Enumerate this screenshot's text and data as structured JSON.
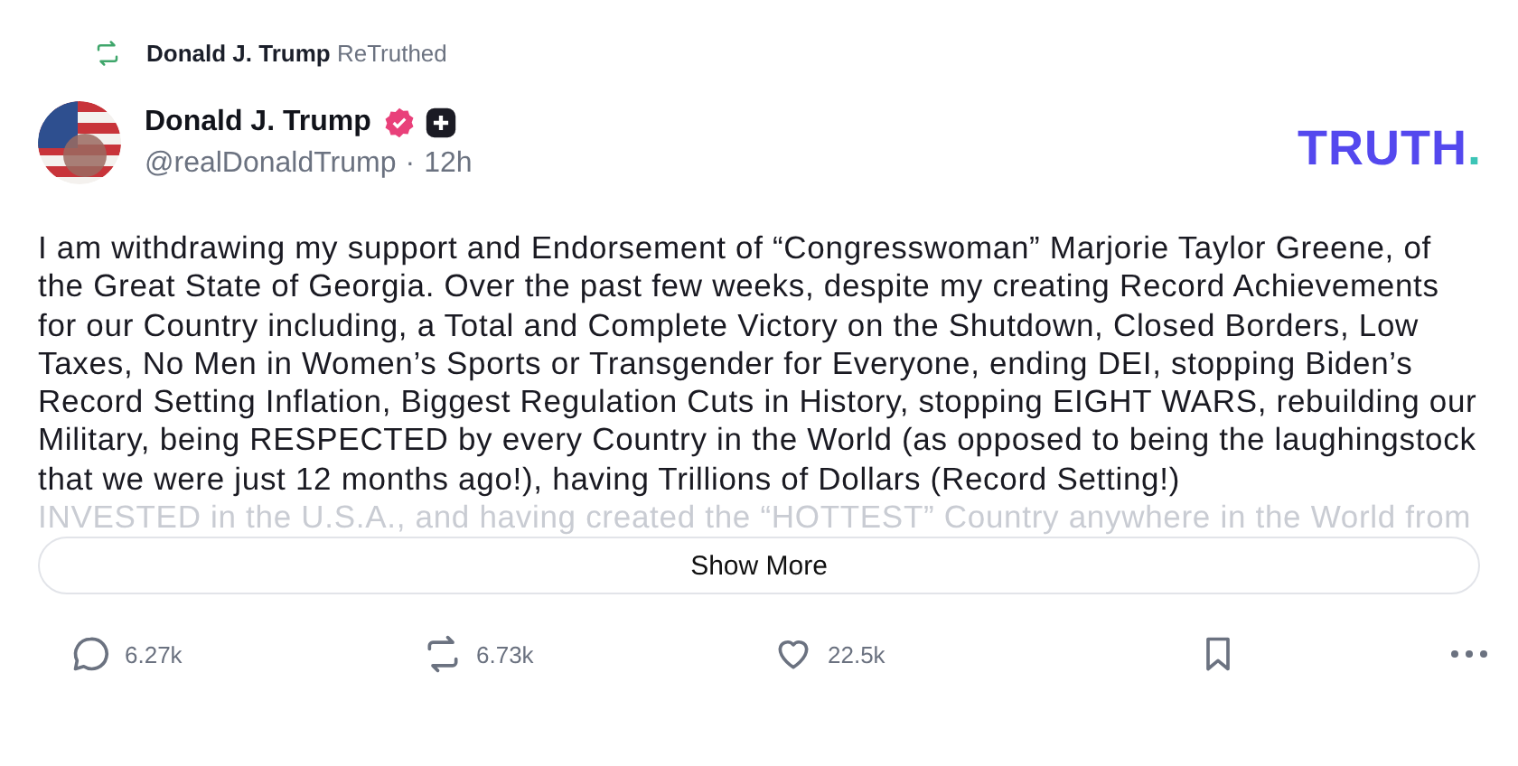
{
  "repost_banner": {
    "name": "Donald J. Trump",
    "action": "ReTruthed"
  },
  "author": {
    "name": "Donald J. Trump",
    "verified": true,
    "plus_badge": true,
    "handle": "@realDonaldTrump",
    "separator": "·",
    "time": "12h"
  },
  "logo": "TRUTH.",
  "post": {
    "text": "I am withdrawing my support and Endorsement of “Congresswoman” Marjorie Taylor Greene, of the Great State of Georgia. Over the past few weeks, despite my creating Record Achievements for our Country including, a Total and Complete Victory on the Shutdown, Closed Borders, Low Taxes, No Men in Women’s Sports or Transgender for Everyone, ending DEI, stopping Biden’s Record Setting Inflation, Biggest Regulation Cuts in History, stopping EIGHT WARS, rebuilding our Military, being RESPECTED by every Country in the World (as opposed to being the laughingstock that we were just 12 months ago!), having Trillions of Dollars (Record Setting!)",
    "faded_text": "INVESTED in the U.S.A., and having created the “HOTTEST” Country anywhere in the World from"
  },
  "show_more": "Show More",
  "actions": [
    {
      "kind": "reply",
      "count": "6.27k"
    },
    {
      "kind": "retruth",
      "count": "6.73k"
    },
    {
      "kind": "like",
      "count": "22.5k"
    },
    {
      "kind": "bookmark"
    },
    {
      "kind": "more"
    }
  ]
}
